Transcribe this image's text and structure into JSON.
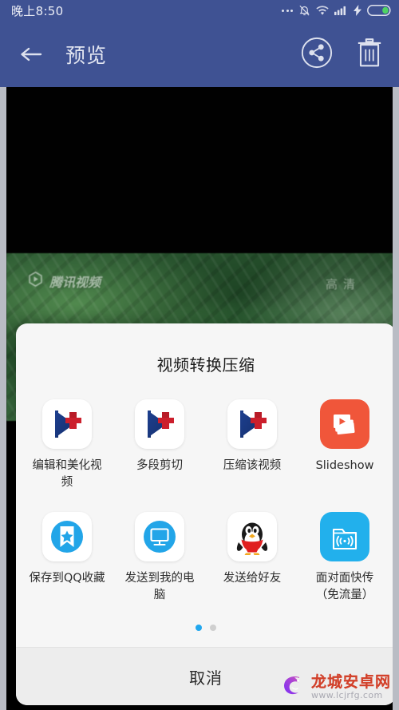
{
  "statusbar": {
    "clock": "晚上8:50",
    "icons": [
      "more-dots",
      "bell-muted",
      "wifi",
      "signal-bars",
      "charging-bolt",
      "battery"
    ]
  },
  "appbar": {
    "back_label": "back-arrow",
    "title": "预览",
    "actions": [
      {
        "name": "share",
        "icon": "share-circle-icon"
      },
      {
        "name": "delete",
        "icon": "trash-icon"
      }
    ]
  },
  "player": {
    "watermark_label": "腾讯视频",
    "quality_badge": "高清",
    "play_icon": "play-triangle-icon"
  },
  "sheet": {
    "title": "视频转换压缩",
    "rows": [
      [
        {
          "label": "编辑和美化视频",
          "icon": "vidtrim-logo-icon"
        },
        {
          "label": "多段剪切",
          "icon": "vidtrim-logo-icon"
        },
        {
          "label": "压缩该视频",
          "icon": "vidtrim-logo-icon"
        },
        {
          "label": "Slideshow",
          "icon": "slideshow-icon"
        }
      ],
      [
        {
          "label": "保存到QQ收藏",
          "icon": "qq-favorite-bookmark-icon"
        },
        {
          "label": "发送到我的电脑",
          "icon": "monitor-icon"
        },
        {
          "label": "发送给好友",
          "icon": "qq-penguin-icon"
        },
        {
          "label": "面对面快传（免流量）",
          "icon": "folder-broadcast-icon"
        }
      ]
    ],
    "pager": {
      "count": 2,
      "active_index": 0
    },
    "cancel_label": "取消"
  },
  "watermark": {
    "name": "龙城安卓网",
    "url": "www.lcjrfg.com",
    "logo": "dragon-logo-icon"
  },
  "colors": {
    "appbar_blue": "#3f5293",
    "accent_blue": "#21a7ee",
    "slideshow_orange": "#f0563a",
    "sheet_bg": "#f6f6f6"
  }
}
